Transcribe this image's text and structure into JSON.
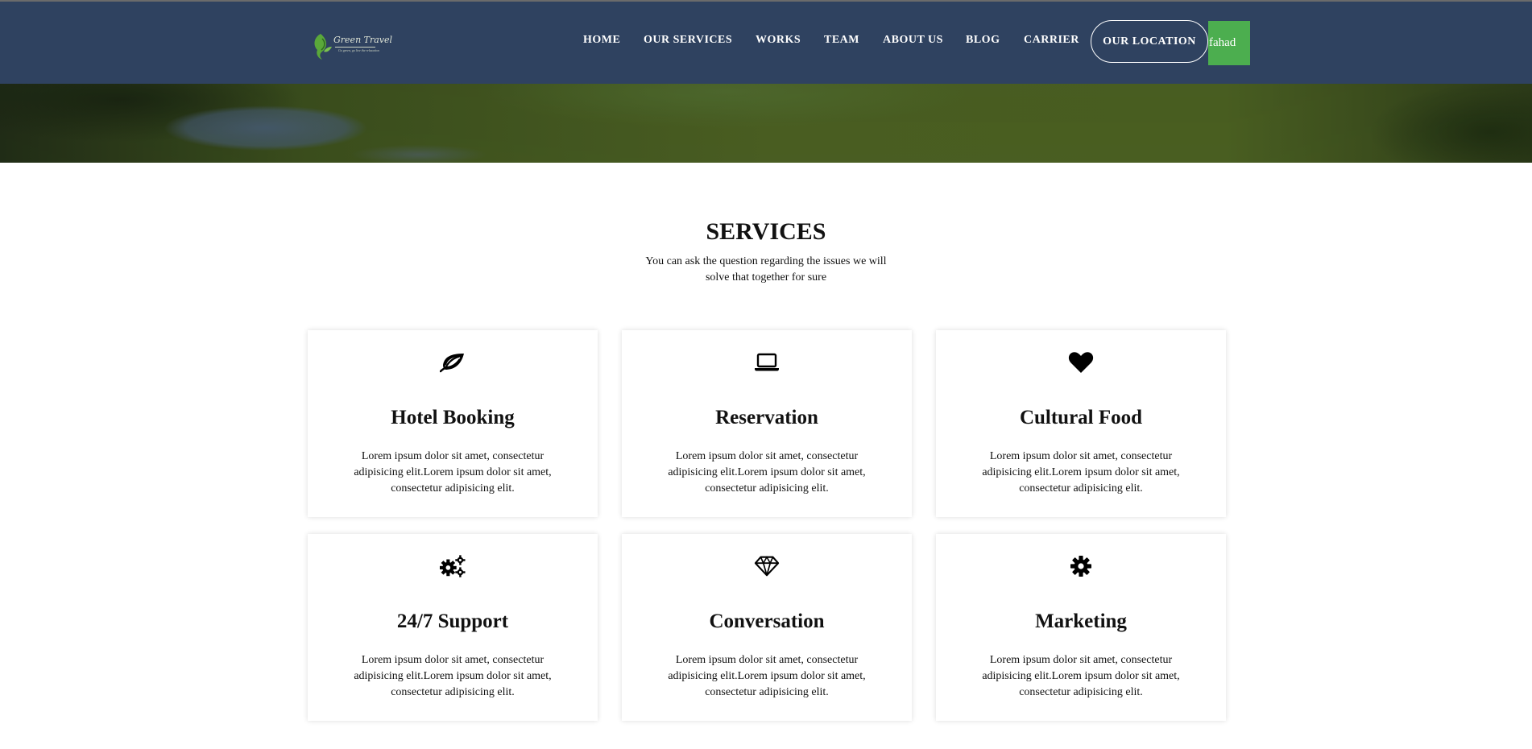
{
  "header": {
    "logo": {
      "name": "Green Travel",
      "tagline": "Go green, go live the relaxation"
    },
    "nav": [
      {
        "label": "HOME"
      },
      {
        "label": "OUR SERVICES"
      },
      {
        "label": "WORKS"
      },
      {
        "label": "TEAM"
      },
      {
        "label": "ABOUT US"
      },
      {
        "label": "BLOG"
      },
      {
        "label": "CARRIER"
      }
    ],
    "location_button": "OUR LOCATION",
    "user_button": "fahad"
  },
  "services": {
    "title": "SERVICES",
    "subtitle": "You can ask the question regarding the issues we will solve that together for sure",
    "cards": [
      {
        "icon": "leaf-icon",
        "title": "Hotel Booking",
        "text": "Lorem ipsum dolor sit amet, consectetur adipisicing elit.Lorem ipsum dolor sit amet, consectetur adipisicing elit."
      },
      {
        "icon": "laptop-icon",
        "title": "Reservation",
        "text": "Lorem ipsum dolor sit amet, consectetur adipisicing elit.Lorem ipsum dolor sit amet, consectetur adipisicing elit."
      },
      {
        "icon": "heart-icon",
        "title": "Cultural Food",
        "text": "Lorem ipsum dolor sit amet, consectetur adipisicing elit.Lorem ipsum dolor sit amet, consectetur adipisicing elit."
      },
      {
        "icon": "cogs-icon",
        "title": "24/7 Support",
        "text": "Lorem ipsum dolor sit amet, consectetur adipisicing elit.Lorem ipsum dolor sit amet, consectetur adipisicing elit."
      },
      {
        "icon": "diamond-icon",
        "title": "Conversation",
        "text": "Lorem ipsum dolor sit amet, consectetur adipisicing elit.Lorem ipsum dolor sit amet, consectetur adipisicing elit."
      },
      {
        "icon": "gear-icon",
        "title": "Marketing",
        "text": "Lorem ipsum dolor sit amet, consectetur adipisicing elit.Lorem ipsum dolor sit amet, consectetur adipisicing elit."
      }
    ]
  },
  "colors": {
    "navbar_bg": "#2f4260",
    "accent_green": "#4cae4f",
    "text": "#111111"
  }
}
